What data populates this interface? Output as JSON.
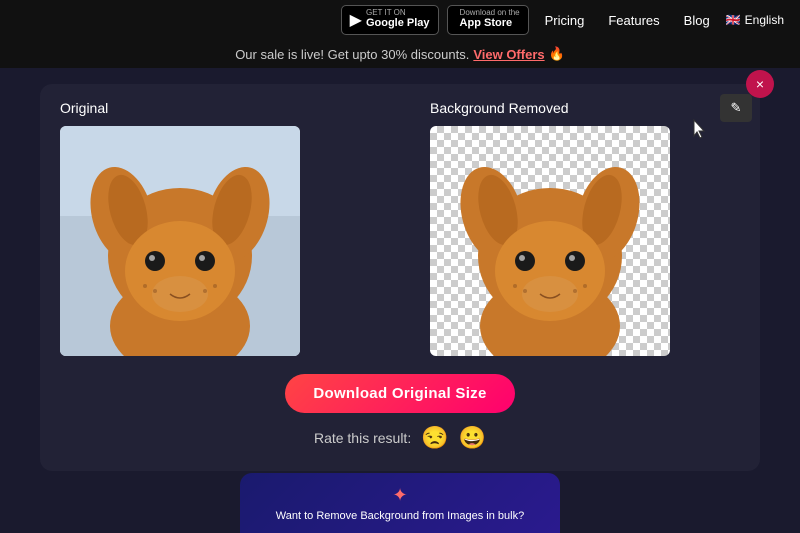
{
  "navbar": {
    "google_play": {
      "top_text": "GET IT ON",
      "bottom_text": "Google Play",
      "icon": "▶"
    },
    "app_store": {
      "top_text": "Download on the",
      "bottom_text": "App Store",
      "icon": ""
    },
    "pricing_label": "Pricing",
    "features_label": "Features",
    "blog_label": "Blog",
    "language_label": "English",
    "flag": "🇬🇧"
  },
  "sale_banner": {
    "text": "Our sale is live! Get upto 30% discounts.",
    "link_text": "View Offers",
    "emoji": "🔥"
  },
  "result": {
    "original_label": "Original",
    "removed_label": "Background Removed",
    "download_btn": "Download Original Size",
    "rate_text": "Rate this result:",
    "sad_emoji": "😒",
    "happy_emoji": "😀",
    "close_icon": "×",
    "edit_icon": "✎"
  },
  "cta_banner": {
    "icon": "✦",
    "text": "Want to Remove Background from Images in bulk?"
  }
}
